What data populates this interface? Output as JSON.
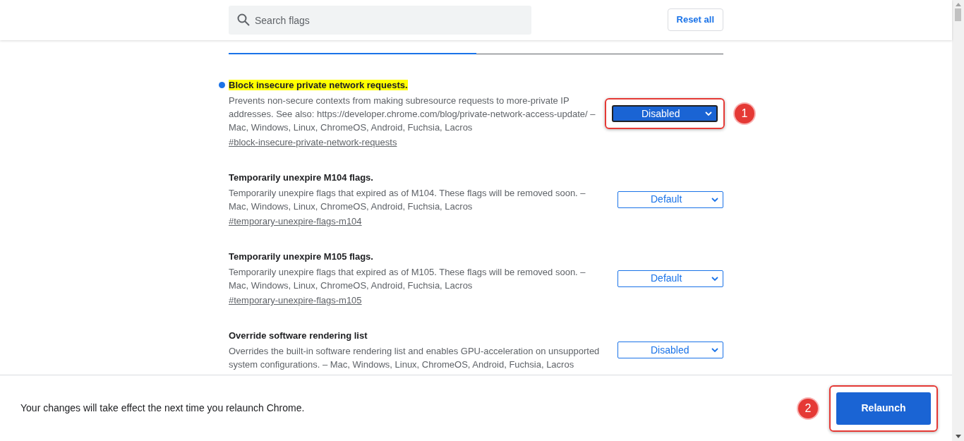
{
  "search": {
    "placeholder": "Search flags"
  },
  "reset_button": "Reset all",
  "tabs": [
    {
      "selected": true
    },
    {
      "selected": false
    }
  ],
  "flags": [
    {
      "title": "Block insecure private network requests.",
      "highlighted": true,
      "description": "Prevents non-secure contexts from making subresource requests to more-private IP addresses. See also: https://developer.chrome.com/blog/private-network-access-update/ – Mac, Windows, Linux, ChromeOS, Android, Fuchsia, Lacros",
      "link": "#block-insecure-private-network-requests",
      "value": "Disabled",
      "annotation": "1"
    },
    {
      "title": "Temporarily unexpire M104 flags.",
      "highlighted": false,
      "description": "Temporarily unexpire flags that expired as of M104. These flags will be removed soon. – Mac, Windows, Linux, ChromeOS, Android, Fuchsia, Lacros",
      "link": "#temporary-unexpire-flags-m104",
      "value": "Default"
    },
    {
      "title": "Temporarily unexpire M105 flags.",
      "highlighted": false,
      "description": "Temporarily unexpire flags that expired as of M105. These flags will be removed soon. – Mac, Windows, Linux, ChromeOS, Android, Fuchsia, Lacros",
      "link": "#temporary-unexpire-flags-m105",
      "value": "Default"
    },
    {
      "title": "Override software rendering list",
      "highlighted": false,
      "description": "Overrides the built-in software rendering list and enables GPU-acceleration on unsupported system configurations. – Mac, Windows, Linux, ChromeOS, Android, Fuchsia, Lacros",
      "value": "Disabled"
    }
  ],
  "footer": {
    "message": "Your changes will take effect the next time you relaunch Chrome.",
    "button": "Relaunch",
    "annotation": "2"
  }
}
